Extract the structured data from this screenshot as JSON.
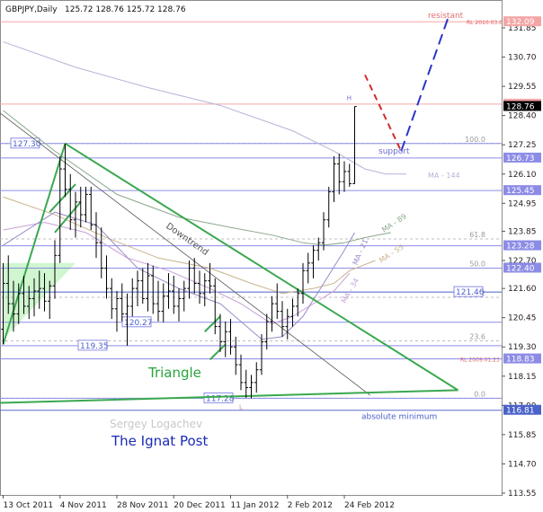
{
  "header": {
    "symbol_label": "GBPJPY,Daily",
    "ohlc_label": "125.72 128.76 125.72 128.76"
  },
  "chart_data": {
    "type": "candlestick",
    "title": "GBPJPY,Daily",
    "symbol": "GBPJPY",
    "timeframe": "Daily",
    "last_ohlc": {
      "open": 125.72,
      "high": 128.76,
      "low": 125.72,
      "close": 128.76
    },
    "y_ticks": [
      113.55,
      114.7,
      115.85,
      117.0,
      118.15,
      119.3,
      120.45,
      121.6,
      122.7,
      123.85,
      124.95,
      126.1,
      127.25,
      128.4,
      129.55,
      130.7,
      131.85
    ],
    "x_ticks": [
      "13 Oct 2011",
      "4 Nov 2011",
      "28 Nov 2011",
      "20 Dec 2011",
      "11 Jan 2012",
      "2 Feb 2012",
      "24 Feb 2012"
    ],
    "ylim": [
      113.2,
      132.5
    ],
    "ohlc": [
      [
        120.0,
        122.6,
        119.4,
        121.8
      ],
      [
        121.8,
        122.9,
        120.6,
        121.0
      ],
      [
        121.0,
        121.9,
        119.9,
        120.6
      ],
      [
        120.6,
        121.8,
        120.2,
        121.4
      ],
      [
        121.4,
        122.1,
        120.6,
        120.9
      ],
      [
        120.9,
        121.7,
        120.4,
        121.2
      ],
      [
        121.2,
        122.0,
        120.5,
        121.5
      ],
      [
        121.5,
        122.3,
        120.8,
        121.6
      ],
      [
        121.6,
        122.2,
        120.7,
        121.1
      ],
      [
        121.1,
        121.9,
        120.4,
        121.7
      ],
      [
        121.7,
        123.5,
        121.2,
        122.9
      ],
      [
        122.9,
        126.8,
        122.6,
        126.3
      ],
      [
        126.3,
        127.3,
        125.2,
        125.5
      ],
      [
        125.5,
        126.1,
        123.9,
        124.3
      ],
      [
        124.3,
        125.4,
        123.6,
        125.0
      ],
      [
        125.0,
        125.6,
        124.0,
        124.5
      ],
      [
        124.5,
        125.6,
        124.2,
        125.3
      ],
      [
        125.3,
        125.6,
        123.9,
        124.1
      ],
      [
        124.1,
        124.6,
        122.8,
        123.4
      ],
      [
        123.4,
        124.0,
        122.0,
        122.4
      ],
      [
        122.4,
        122.9,
        121.2,
        121.6
      ],
      [
        121.6,
        122.0,
        120.4,
        120.8
      ],
      [
        120.8,
        121.5,
        119.9,
        121.2
      ],
      [
        121.2,
        121.8,
        120.3,
        120.6
      ],
      [
        120.6,
        121.4,
        119.35,
        120.9
      ],
      [
        120.9,
        122.0,
        120.5,
        121.6
      ],
      [
        121.6,
        122.3,
        120.9,
        121.9
      ],
      [
        121.9,
        122.4,
        121.0,
        121.2
      ],
      [
        121.2,
        122.6,
        120.7,
        122.1
      ],
      [
        122.1,
        122.5,
        120.6,
        121.0
      ],
      [
        121.0,
        121.9,
        120.3,
        120.7
      ],
      [
        120.7,
        121.8,
        120.27,
        121.3
      ],
      [
        121.3,
        122.2,
        120.8,
        121.5
      ],
      [
        121.5,
        122.1,
        120.6,
        120.9
      ],
      [
        120.9,
        121.6,
        120.3,
        121.2
      ],
      [
        121.2,
        121.9,
        120.7,
        121.6
      ],
      [
        121.6,
        122.7,
        121.2,
        122.4
      ],
      [
        122.4,
        122.8,
        121.4,
        121.8
      ],
      [
        121.8,
        122.3,
        121.0,
        121.4
      ],
      [
        121.4,
        122.2,
        120.9,
        121.9
      ],
      [
        121.9,
        122.6,
        121.4,
        121.7
      ],
      [
        121.7,
        122.0,
        119.8,
        120.1
      ],
      [
        120.1,
        120.6,
        119.1,
        119.5
      ],
      [
        119.5,
        120.3,
        118.9,
        119.9
      ],
      [
        119.9,
        120.4,
        119.0,
        119.3
      ],
      [
        119.3,
        119.7,
        118.2,
        118.6
      ],
      [
        118.6,
        119.0,
        117.6,
        117.9
      ],
      [
        117.9,
        118.4,
        117.3,
        117.7
      ],
      [
        117.7,
        118.2,
        117.28,
        117.9
      ],
      [
        117.9,
        118.7,
        117.5,
        118.4
      ],
      [
        118.4,
        119.8,
        118.2,
        119.5
      ],
      [
        119.5,
        120.6,
        119.2,
        120.3
      ],
      [
        120.3,
        121.3,
        119.9,
        121.0
      ],
      [
        121.0,
        121.8,
        120.4,
        120.7
      ],
      [
        120.7,
        121.1,
        119.7,
        120.1
      ],
      [
        120.1,
        120.8,
        119.6,
        120.5
      ],
      [
        120.5,
        121.2,
        120.1,
        120.9
      ],
      [
        120.9,
        121.6,
        120.5,
        121.4
      ],
      [
        121.4,
        122.6,
        121.0,
        122.3
      ],
      [
        122.3,
        123.0,
        121.8,
        122.6
      ],
      [
        122.6,
        123.3,
        122.0,
        123.1
      ],
      [
        123.1,
        123.6,
        122.7,
        123.4
      ],
      [
        123.4,
        124.6,
        123.1,
        124.3
      ],
      [
        124.3,
        125.6,
        124.0,
        125.4
      ],
      [
        125.4,
        126.8,
        125.0,
        126.5
      ],
      [
        126.5,
        126.9,
        125.3,
        125.8
      ],
      [
        125.8,
        126.6,
        125.4,
        126.2
      ],
      [
        126.2,
        126.5,
        125.6,
        125.72
      ],
      [
        125.72,
        128.76,
        125.72,
        128.76
      ]
    ],
    "moving_averages": [
      {
        "label": "MA - 144",
        "color": "#b4b4d8",
        "points": [
          [
            0,
            131.3
          ],
          [
            14,
            130.3
          ],
          [
            28,
            129.5
          ],
          [
            42,
            128.8
          ],
          [
            56,
            127.8
          ],
          [
            64,
            127.0
          ],
          [
            70,
            126.3
          ],
          [
            74,
            126.1
          ],
          [
            78,
            126.1
          ]
        ]
      },
      {
        "label": "MA - 89",
        "color": "#8aa88a",
        "points": [
          [
            0,
            128.6
          ],
          [
            10,
            127.0
          ],
          [
            22,
            125.3
          ],
          [
            34,
            124.4
          ],
          [
            44,
            124.0
          ],
          [
            52,
            123.7
          ],
          [
            58,
            123.4
          ],
          [
            62,
            123.3
          ],
          [
            66,
            123.4
          ],
          [
            70,
            123.6
          ],
          [
            75,
            123.8
          ]
        ]
      },
      {
        "label": "MA - 55",
        "color": "#c8b48c",
        "points": [
          [
            0,
            125.2
          ],
          [
            10,
            124.5
          ],
          [
            20,
            123.6
          ],
          [
            30,
            122.8
          ],
          [
            40,
            122.4
          ],
          [
            48,
            121.8
          ],
          [
            54,
            121.4
          ],
          [
            60,
            121.6
          ],
          [
            64,
            121.8
          ],
          [
            67,
            122.3
          ],
          [
            72,
            122.7
          ]
        ]
      },
      {
        "label": "MA - 34",
        "color": "#c8a0d8",
        "points": [
          [
            0,
            123.9
          ],
          [
            8,
            124.2
          ],
          [
            16,
            123.8
          ],
          [
            24,
            122.8
          ],
          [
            32,
            122.3
          ],
          [
            40,
            121.6
          ],
          [
            46,
            121.0
          ],
          [
            52,
            120.2
          ],
          [
            56,
            120.5
          ],
          [
            60,
            121.0
          ],
          [
            64,
            121.5
          ],
          [
            67,
            122.2
          ]
        ]
      },
      {
        "label": "MA - 21",
        "color": "#9a8ac8",
        "points": [
          [
            0,
            123.3
          ],
          [
            10,
            124.6
          ],
          [
            18,
            124.1
          ],
          [
            26,
            122.4
          ],
          [
            34,
            121.6
          ],
          [
            42,
            121.0
          ],
          [
            50,
            119.6
          ],
          [
            54,
            119.7
          ],
          [
            58,
            120.5
          ],
          [
            62,
            121.8
          ],
          [
            66,
            123.1
          ],
          [
            68,
            123.8
          ]
        ]
      }
    ],
    "horizontal_levels": [
      {
        "value": 127.3,
        "label": "127.30"
      },
      {
        "value": 126.73,
        "label": "126.73"
      },
      {
        "value": 125.45,
        "label": "125.45"
      },
      {
        "value": 123.28,
        "label": "123.28"
      },
      {
        "value": 122.4,
        "label": "122.40"
      },
      {
        "value": 121.46,
        "label": "121.46"
      },
      {
        "value": 120.27,
        "label": "120.27"
      },
      {
        "value": 119.35,
        "label": "119.35"
      },
      {
        "value": 118.83,
        "label": "118.83"
      },
      {
        "value": 117.28,
        "label": "117.28"
      },
      {
        "value": 116.81,
        "label": "116.81"
      }
    ],
    "fibo_levels": [
      {
        "value": 127.3,
        "label": "100.0"
      },
      {
        "value": 123.55,
        "label": "61.8"
      },
      {
        "value": 122.4,
        "label": "50.0"
      },
      {
        "value": 121.25,
        "label": "38.2"
      },
      {
        "value": 119.54,
        "label": "23.6"
      },
      {
        "value": 117.28,
        "label": "0.0"
      }
    ],
    "resistance_lines": [
      {
        "value": 132.09,
        "label": "RL 2010.03.0",
        "price": "132.09"
      },
      {
        "value": 128.85,
        "label": "",
        "price": "128.85"
      },
      {
        "value": 118.83,
        "label": "RL 2009.01.23",
        "price": ""
      }
    ],
    "forecast": {
      "red_x": [
        70,
        77
      ],
      "red_y": [
        130.0,
        127.0
      ],
      "blue_x": [
        77,
        86
      ],
      "blue_y": [
        127.0,
        132.2
      ]
    },
    "annotations": {
      "resistant": "resistant",
      "support": "support",
      "downtrend": "Downtrend",
      "triangle": "Triangle",
      "absolute_minimum": "absolute minimum",
      "author": "Sergey Logachev",
      "site": "The Ignat Post",
      "high_marker": "H",
      "low_marker": "L"
    },
    "current_price": "128.76"
  }
}
